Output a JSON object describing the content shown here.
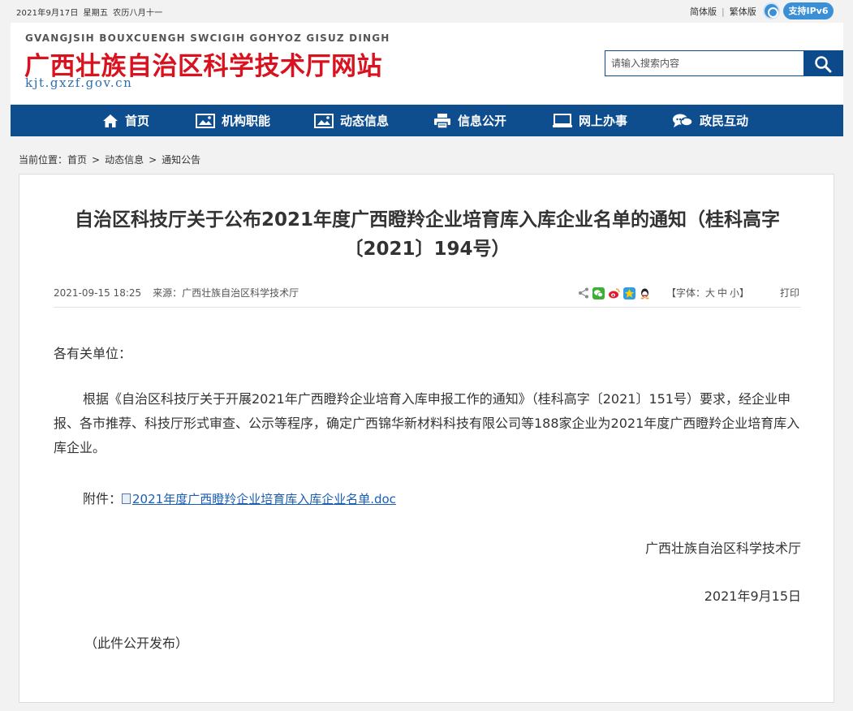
{
  "topbar": {
    "date": "2021年9月17日",
    "weekday": "星期五",
    "lunar": "农历八月十一",
    "lang_simplified": "简体版",
    "lang_traditional": "繁体版",
    "ipv6": "支持IPv6"
  },
  "header": {
    "pinyin": "GVANGJSIH BOUXCUENGH SWCIGIH GOHYOZ GISUZ DINGH",
    "title": "广西壮族自治区科学技术厅网站",
    "domain": "kjt.gxzf.gov.cn",
    "title_color": "#d8121f"
  },
  "search": {
    "placeholder": "请输入搜索内容",
    "icon": "search-icon"
  },
  "nav": {
    "color": "#0e4e8e",
    "items": [
      {
        "label": "首页",
        "icon": "home-icon"
      },
      {
        "label": "机构职能",
        "icon": "image-icon"
      },
      {
        "label": "动态信息",
        "icon": "image-icon"
      },
      {
        "label": "信息公开",
        "icon": "printer-icon"
      },
      {
        "label": "网上办事",
        "icon": "monitor-icon"
      },
      {
        "label": "政民互动",
        "icon": "chat-icon"
      }
    ]
  },
  "breadcrumb": {
    "prefix": "当前位置：",
    "items": [
      "首页",
      "动态信息",
      "通知公告"
    ]
  },
  "article": {
    "title": "自治区科技厅关于公布2021年度广西瞪羚企业培育库入库企业名单的通知（桂科高字〔2021〕194号）",
    "datetime": "2021-09-15 18:25",
    "source": "来源：广西壮族自治区科学技术厅",
    "share_icons": [
      "share-icon",
      "wechat-icon",
      "weibo-icon",
      "qzone-icon",
      "qq-icon"
    ],
    "font_label": "【字体：",
    "font_large": "大",
    "font_medium": "中",
    "font_small": "小】",
    "print": "打印",
    "salutation": "各有关单位：",
    "paragraph": "根据《自治区科技厅关于开展2021年广西瞪羚企业培育入库申报工作的通知》（桂科高字〔2021〕151号）要求，经企业申报、各市推荐、科技厅形式审查、公示等程序，确定广西锦华新材料科技有限公司等188家企业为2021年度广西瞪羚企业培育库入库企业。",
    "attachment_label": "附件：",
    "attachment_link": "2021年度广西瞪羚企业培育库入库企业名单.doc",
    "signature": "广西壮族自治区科学技术厅",
    "sign_date": "2021年9月15日",
    "public_note": "（此件公开发布）"
  }
}
